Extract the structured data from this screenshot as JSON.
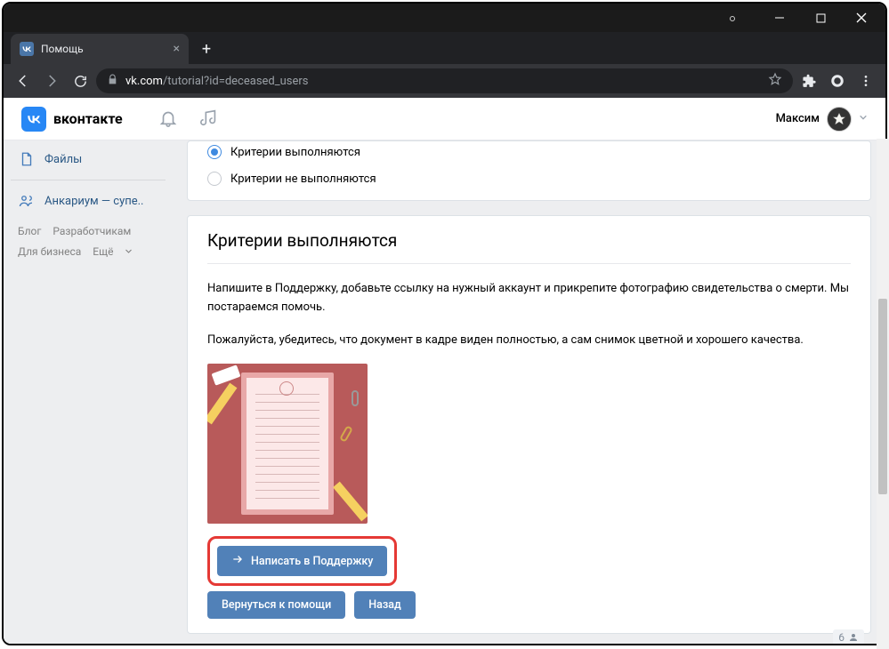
{
  "window": {
    "tab_title": "Помощь"
  },
  "browser": {
    "url_domain": "vk.com",
    "url_path": "/tutorial?id=deceased_users"
  },
  "vk_header": {
    "brand": "вконтакте",
    "username": "Максим"
  },
  "sidebar": {
    "items": [
      {
        "icon": "file-icon",
        "label": "Файлы"
      },
      {
        "icon": "group-icon",
        "label": "Анкариум — супе.."
      }
    ],
    "footer": {
      "blog": "Блог",
      "devs": "Разработчикам",
      "business": "Для бизнеса",
      "more": "Ещё"
    }
  },
  "radios": {
    "option1": "Критерии выполняются",
    "option2": "Критерии не выполняются"
  },
  "section": {
    "title": "Критерии выполняются",
    "para1": "Напишите в Поддержку, добавьте ссылку на нужный аккаунт и прикрепите фотографию свидетельства о смерти. Мы постараемся помочь.",
    "para2": "Пожалуйста, убедитесь, что документ в кадре виден полностью, а сам снимок цветной и хорошего качества."
  },
  "buttons": {
    "write_support": "Написать в Поддержку",
    "back_help": "Вернуться к помощи",
    "back": "Назад"
  },
  "counter": "6"
}
